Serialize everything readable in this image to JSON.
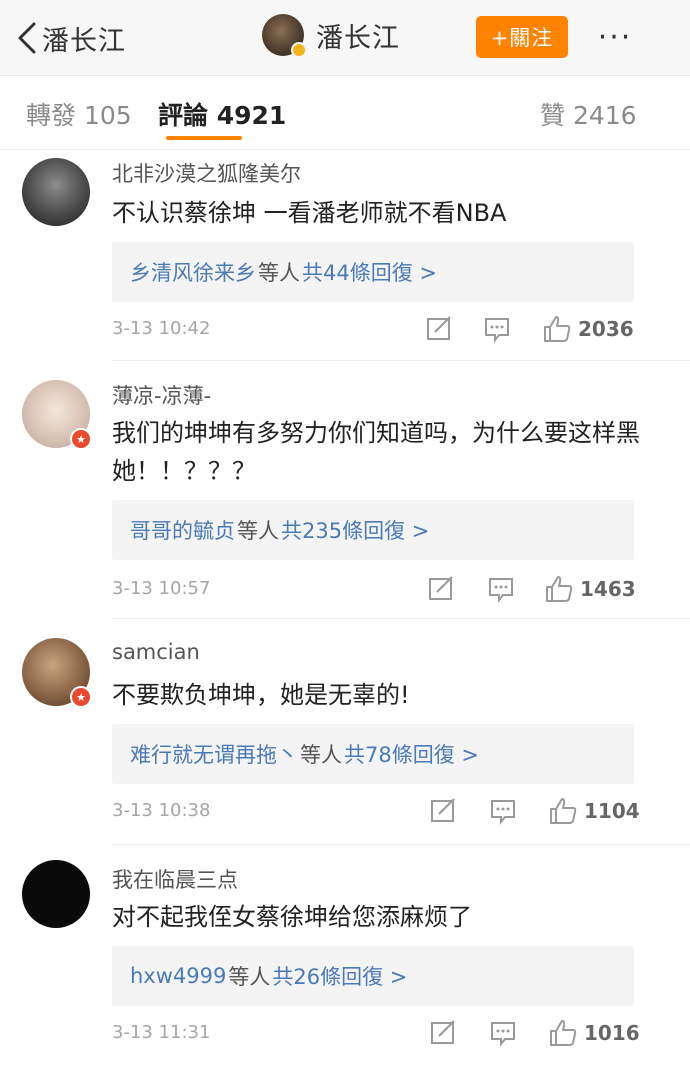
{
  "header": {
    "back_label": "潘长江",
    "profile_name": "潘长江",
    "follow_label": "+關注",
    "more_label": "···"
  },
  "tabs": [
    {
      "label": "轉發",
      "count": "105"
    },
    {
      "label": "評論",
      "count": "4921"
    },
    {
      "label": "贊",
      "count": "2416"
    }
  ],
  "comments": [
    {
      "user": "北非沙漠之狐隆美尔",
      "text": "不认识蔡徐坤 一看潘老师就不看NBA",
      "reply_users": "乡清风徐来乡",
      "reply_mid": "等人",
      "reply_count": "共44條回復 >",
      "time": "3-13 10:42",
      "likes": "2036"
    },
    {
      "user": "薄凉-凉薄-",
      "text": "我们的坤坤有多努力你们知道吗，为什么要这样黑她！！？？？",
      "reply_users": "哥哥的毓贞",
      "reply_mid": "等人",
      "reply_count": "共235條回復 >",
      "time": "3-13 10:57",
      "likes": "1463"
    },
    {
      "user": "samcian",
      "text": "不要欺负坤坤，她是无辜的!",
      "reply_users": "难行就无谓再拖丶",
      "reply_mid": "等人",
      "reply_count": "共78條回復 >",
      "time": "3-13 10:38",
      "likes": "1104"
    },
    {
      "user": "我在临晨三点",
      "text": "对不起我侄女蔡徐坤给您添麻烦了",
      "reply_users": "hxw4999",
      "reply_mid": "等人",
      "reply_count": "共26條回復 >",
      "time": "3-13 11:31",
      "likes": "1016"
    }
  ],
  "colors": {
    "accent": "#ff8200",
    "link": "#4a7ab8",
    "verified_badge": "#e8492f",
    "gold_badge": "#f5b31b"
  }
}
